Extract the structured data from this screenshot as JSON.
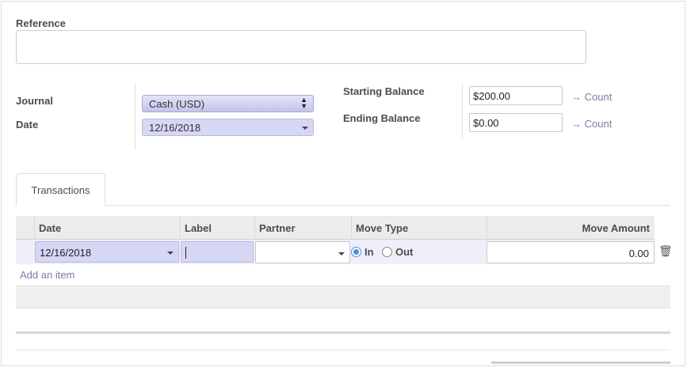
{
  "reference": {
    "label": "Reference",
    "value": ""
  },
  "journal": {
    "label": "Journal",
    "value": "Cash (USD)"
  },
  "date": {
    "label": "Date",
    "value": "12/16/2018"
  },
  "starting_balance": {
    "label": "Starting Balance",
    "value": "$200.00",
    "link": "→ Count"
  },
  "ending_balance": {
    "label": "Ending Balance",
    "value": "$0.00",
    "link": "→ Count"
  },
  "tabs": [
    {
      "label": "Transactions",
      "active": true
    }
  ],
  "table": {
    "columns": [
      "Date",
      "Label",
      "Partner",
      "Move Type",
      "Move Amount"
    ],
    "editing_row": {
      "date": "12/16/2018",
      "label": "",
      "partner": "",
      "move_type_options": [
        "In",
        "Out"
      ],
      "move_type_selected": "In",
      "amount": "0.00",
      "delete_icon": "trash-icon"
    },
    "add_item_label": "Add an item"
  },
  "colors": {
    "field_highlight": "#d6d6f5",
    "link": "#7b7bab",
    "radio_active": "#4a90e2"
  }
}
